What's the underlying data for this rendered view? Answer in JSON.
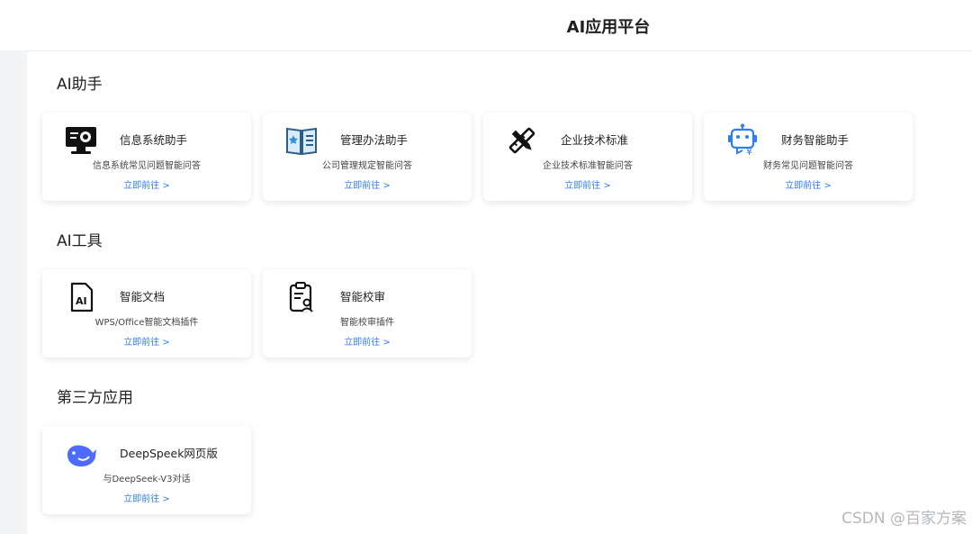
{
  "header": {
    "title": "AI应用平台"
  },
  "sections": [
    {
      "title": "AI助手",
      "cards": [
        {
          "name": "信息系统助手",
          "desc": "信息系统常见问题智能问答",
          "link": "立即前往 >",
          "icon": "monitor-gear-icon"
        },
        {
          "name": "管理办法助手",
          "desc": "公司管理规定智能问答",
          "link": "立即前往 >",
          "icon": "book-icon"
        },
        {
          "name": "企业技术标准",
          "desc": "企业技术标准智能问答",
          "link": "立即前往 >",
          "icon": "ruler-pencil-icon"
        },
        {
          "name": "财务智能助手",
          "desc": "财务常见问题智能问答",
          "link": "立即前往 >",
          "icon": "robot-yen-icon"
        }
      ]
    },
    {
      "title": "AI工具",
      "cards": [
        {
          "name": "智能文档",
          "desc": "WPS/Office智能文档插件",
          "link": "立即前往 >",
          "icon": "ai-document-icon"
        },
        {
          "name": "智能校审",
          "desc": "智能校审插件",
          "link": "立即前往 >",
          "icon": "clipboard-user-icon"
        }
      ]
    },
    {
      "title": "第三方应用",
      "cards": [
        {
          "name": "DeepSpeek网页版",
          "desc": "与DeepSeek-V3对话",
          "link": "立即前往 >",
          "icon": "whale-icon"
        }
      ]
    }
  ],
  "watermark": "CSDN @百家方案"
}
